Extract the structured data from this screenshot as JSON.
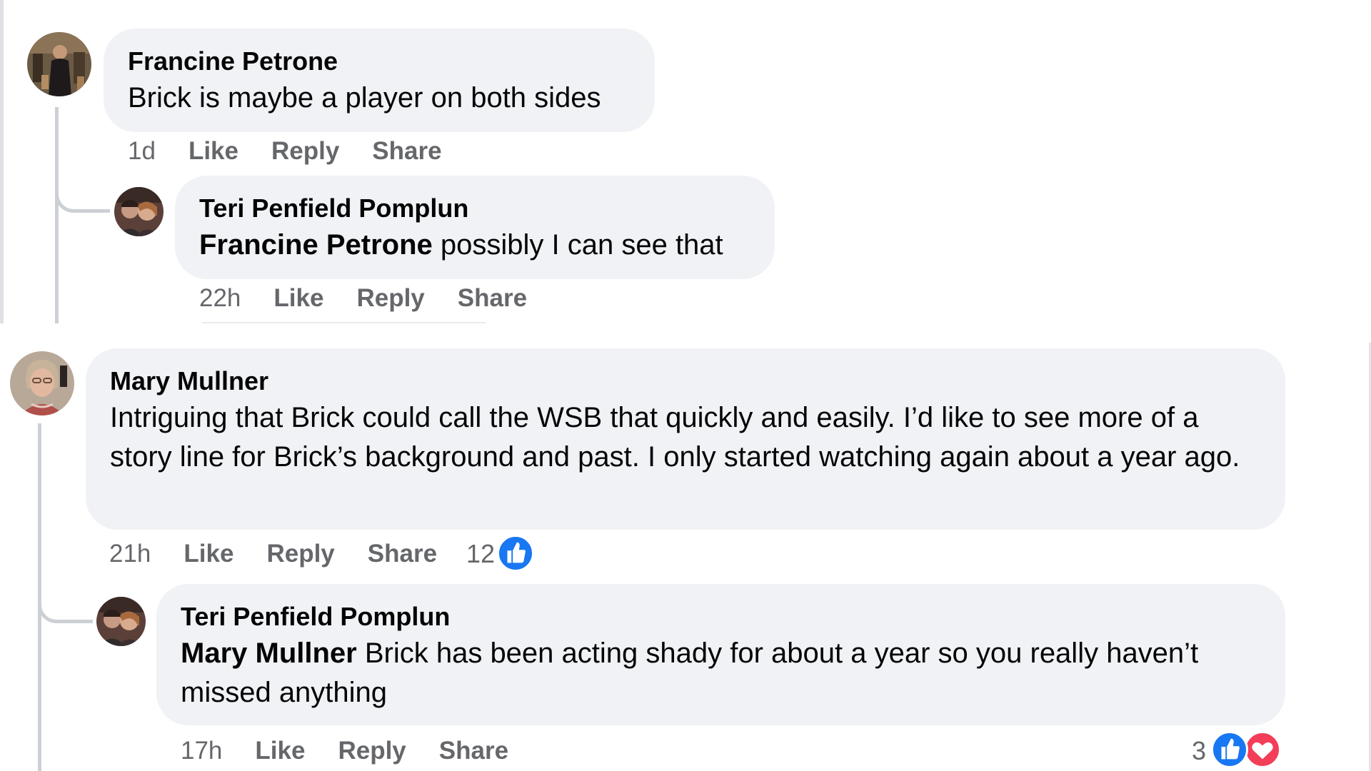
{
  "comments": [
    {
      "author": "Francine Petrone",
      "text": "Brick is maybe a player on both sides",
      "time": "1d",
      "like": "Like",
      "reply": "Reply",
      "share": "Share",
      "replies": [
        {
          "author": "Teri Penfield Pomplun",
          "mention": "Francine Petrone",
          "text": " possibly I can see that",
          "time": "22h",
          "like": "Like",
          "reply": "Reply",
          "share": "Share"
        }
      ]
    },
    {
      "author": "Mary Mullner",
      "text": "Intriguing that Brick could call the WSB that quickly and easily. I’d like to see more of a story line for Brick’s background and past. I only started watching again about a year ago.",
      "time": "21h",
      "like": "Like",
      "reply": "Reply",
      "share": "Share",
      "reaction_count": "12",
      "reactions": [
        "like-icon"
      ],
      "replies": [
        {
          "author": "Teri Penfield Pomplun",
          "mention": "Mary Mullner",
          "text": " Brick has been acting shady for about a year so you really haven’t missed anything",
          "time": "17h",
          "like": "Like",
          "reply": "Reply",
          "share": "Share",
          "reaction_count": "3",
          "reactions": [
            "like-icon",
            "love-icon"
          ]
        }
      ]
    }
  ],
  "colors": {
    "bubble": "#f0f2f5",
    "action_text": "#65676b",
    "like_blue": "#1877f2",
    "love_red": "#f33e58",
    "thread_line": "#ccd0d5"
  }
}
